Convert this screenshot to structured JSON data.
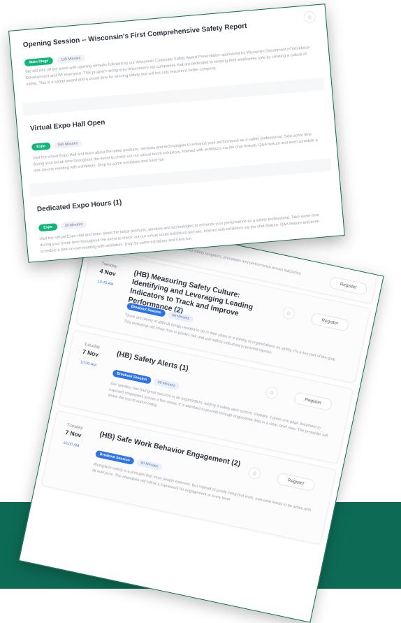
{
  "colors": {
    "brand_green": "#0d6b54",
    "badge_green": "#13b57a",
    "badge_blue": "#2f74e6"
  },
  "icons": {
    "favorite": "star-icon"
  },
  "agenda": {
    "register_label": "Register",
    "sessions": [
      {
        "title": "",
        "badges": [],
        "description": "Join the session to learn about safety programs, processes and performance across industries."
      },
      {
        "date_day": "Tuesday",
        "date_dm": "4 Nov",
        "time": "10:45 AM",
        "title": "(HB) Measuring Safety Culture: Identifying and Leveraging Leading Indicators to Track and Improve Performance (2)",
        "badges": [
          "Breakout Session",
          "60 Minutes"
        ],
        "description": "There are plenty of difficult things needed to do in their place in a variety of organizations on safety. It's a key part of the goal. This workshop will show how to predict risk and use safety indicators to prevent injuries."
      },
      {
        "date_day": "Tuesday",
        "date_dm": "7 Nov",
        "time": "10:00 AM",
        "title": "(HB) Safety Alerts (1)",
        "badges": [
          "Breakout Session",
          "60 Minutes"
        ],
        "description": "Our speaker has had great success in an organization, adding a safety alert system. Globally, it gives one page document to exposed employees across a few areas. It is standard to provide through engineered data in a clear, brief view. The presenter will share the tool in action today."
      },
      {
        "date_day": "Tuesday",
        "date_dm": "7 Nov",
        "time": "10:00 AM",
        "title": "(HB) Safe Work Behavior Engagement (2)",
        "badges": [
          "Breakout Session",
          "60 Minutes"
        ],
        "description": "Workplace safety is a principle that most people examine. But instead of purely living that work, everyone needs to be active with all everyone. The attendees will follow a framework for engagement at every level."
      }
    ]
  },
  "expo": {
    "sessions": [
      {
        "title": "Opening Session -- Wisconsin's First Comprehensive Safety Report",
        "badges": [
          "Main Stage",
          "120 Minutes"
        ],
        "description": "We will kick off the event with opening remarks followed by our Wisconsin Corporate Safety Award Presentation sponsored by Wisconsin Department of Workforce Development and WI Insurance. This program recognizes Wisconsin's top companies that are dedicated to keeping their employees safe by creating a culture of safety. This is a safety award and a proud time for winning safety that will not only result in a better company."
      },
      {
        "title": "Virtual Expo Hall Open",
        "badges": [
          "Expo",
          "540 Minutes"
        ],
        "description": "Visit the virtual Expo Hall and learn about the latest products, services and technologies to enhance your performance as a safety professional. Take some time during your break time throughout the event to check out our virtual booth exhibitors. Interact with exhibitors via the chat feature, Q&A feature and even schedule a one-on-one meeting with exhibitors. Drop by some exhibitors and have fun."
      },
      {
        "title": "Dedicated Expo Hours (1)",
        "badges": [
          "Expo",
          "30 Minutes"
        ],
        "description": "Visit the Virtual Expo Hall and learn about the latest products, services and technologies to enhance your performance as a safety professional. Take some time during your break time throughout the event to check out our virtual booth exhibitors and win. Interact with exhibitors via the chat feature, Q&A feature and even schedule a one-on-one meeting with exhibitors. Drop by some exhibitors and have fun."
      }
    ]
  }
}
